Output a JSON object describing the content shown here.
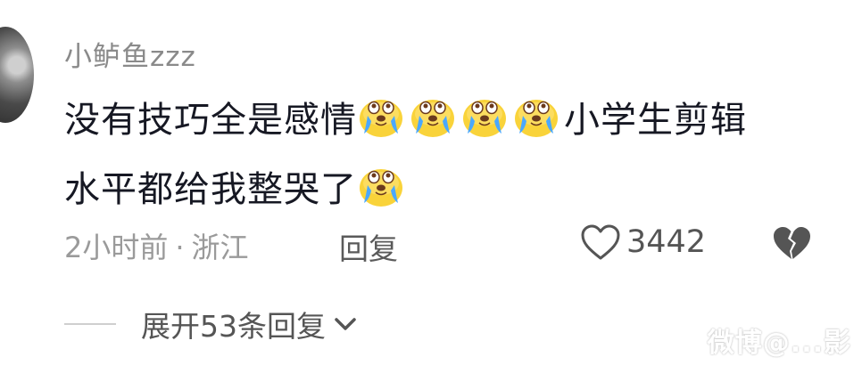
{
  "comment": {
    "username": "小鲈鱼zzz",
    "text_part1": "没有技巧全是感情",
    "text_part2": "小学生剪辑",
    "text_part3": "水平都给我整哭了",
    "emoji_name": "crying-face-emoji",
    "time": "2小时前",
    "separator": "·",
    "location": "浙江",
    "reply_label": "回复",
    "like_count": "3442",
    "expand_label": "展开53条回复"
  },
  "watermark": "微博@...影",
  "colors": {
    "text": "#161823",
    "meta": "#9a9a9a",
    "username": "#8a8a8a",
    "emoji_face": "#f9d33a"
  },
  "icons": {
    "like": "heart-outline-icon",
    "dislike": "broken-heart-icon",
    "expand": "chevron-down-icon"
  }
}
